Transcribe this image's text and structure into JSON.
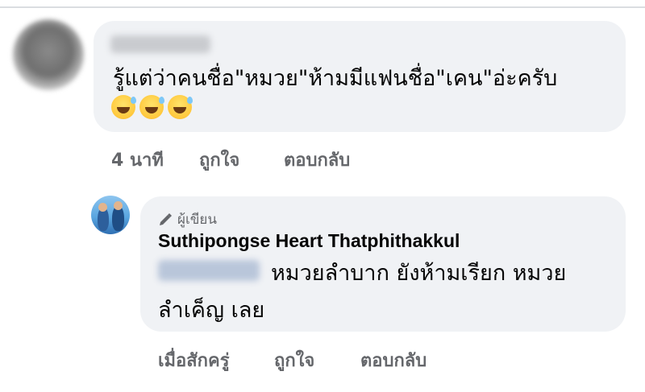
{
  "comment_1": {
    "text": "รู้แต่ว่าคนชื่อ\"หมวย\"ห้ามมีแฟนชื่อ\"เคน\"อ่ะครับ",
    "emoji_icon": "grinning-sweat-emoji",
    "emoji_count": 3,
    "actions": {
      "time": "4 นาที",
      "like": "ถูกใจ",
      "reply": "ตอบกลับ"
    }
  },
  "reply_1": {
    "author_badge": "ผู้เขียน",
    "author_name": "Suthipongse Heart Thatphithakkul",
    "text_line_1": "หมวยลำบาก ยังห้ามเรียก หมวย",
    "text_line_2": "ลำเค็ญ เลย",
    "actions": {
      "time": "เมื่อสักครู่",
      "like": "ถูกใจ",
      "reply": "ตอบกลับ"
    }
  },
  "colors": {
    "bubble": "#f0f2f5",
    "meta_text": "#65676b",
    "body_text": "#050505"
  }
}
